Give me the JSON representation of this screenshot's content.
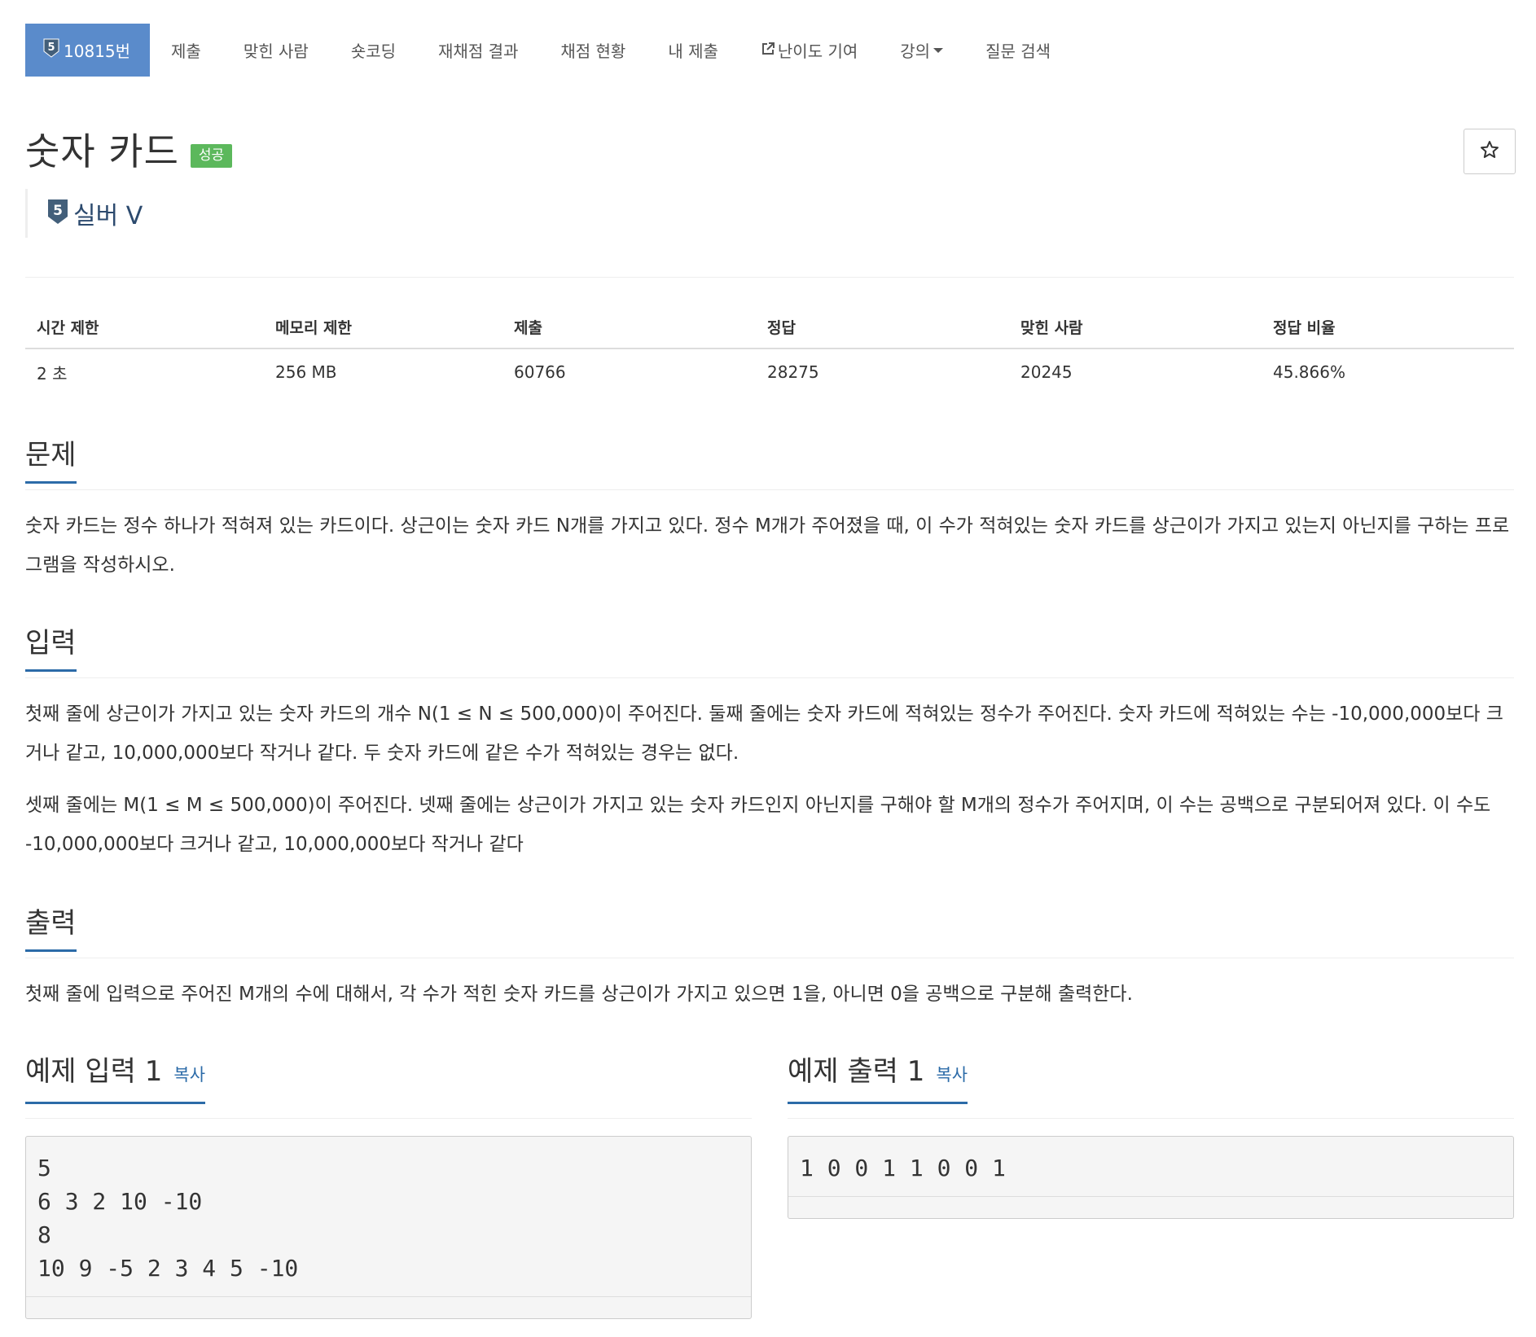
{
  "nav": {
    "problem_id": "10815번",
    "tier_number": "5",
    "items": [
      "제출",
      "맞힌 사람",
      "숏코딩",
      "재채점 결과",
      "채점 현황",
      "내 제출",
      "난이도 기여",
      "강의",
      "질문 검색"
    ]
  },
  "header": {
    "title": "숫자 카드",
    "result_badge": "성공",
    "tier_label": "실버 V",
    "tier_number": "5"
  },
  "info": {
    "headers": [
      "시간 제한",
      "메모리 제한",
      "제출",
      "정답",
      "맞힌 사람",
      "정답 비율"
    ],
    "values": [
      "2 초",
      "256 MB",
      "60766",
      "28275",
      "20245",
      "45.866%"
    ]
  },
  "problem": {
    "title": "문제",
    "paragraphs": [
      "숫자 카드는 정수 하나가 적혀져 있는 카드이다. 상근이는 숫자 카드 N개를 가지고 있다. 정수 M개가 주어졌을 때, 이 수가 적혀있는 숫자 카드를 상근이가 가지고 있는지 아닌지를 구하는 프로그램을 작성하시오."
    ]
  },
  "input": {
    "title": "입력",
    "paragraphs": [
      "첫째 줄에 상근이가 가지고 있는 숫자 카드의 개수 N(1 ≤ N ≤ 500,000)이 주어진다. 둘째 줄에는 숫자 카드에 적혀있는 정수가 주어진다. 숫자 카드에 적혀있는 수는 -10,000,000보다 크거나 같고, 10,000,000보다 작거나 같다. 두 숫자 카드에 같은 수가 적혀있는 경우는 없다.",
      "셋째 줄에는 M(1 ≤ M ≤ 500,000)이 주어진다. 넷째 줄에는 상근이가 가지고 있는 숫자 카드인지 아닌지를 구해야 할 M개의 정수가 주어지며, 이 수는 공백으로 구분되어져 있다. 이 수도 -10,000,000보다 크거나 같고, 10,000,000보다 작거나 같다"
    ]
  },
  "output": {
    "title": "출력",
    "paragraphs": [
      "첫째 줄에 입력으로 주어진 M개의 수에 대해서, 각 수가 적힌 숫자 카드를 상근이가 가지고 있으면 1을, 아니면 0을 공백으로 구분해 출력한다."
    ]
  },
  "samples": {
    "input_title": "예제 입력 1",
    "output_title": "예제 출력 1",
    "copy_label": "복사",
    "input_text": "5\n6 3 2 10 -10\n8\n10 9 -5 2 3 4 5 -10",
    "output_text": "1 0 0 1 1 0 0 1"
  },
  "icons": {
    "tier": "tier-shield-icon",
    "external": "external-link-icon",
    "star": "star-outline-icon",
    "caret": "caret-down-icon"
  },
  "colors": {
    "accent": "#5a8bcb",
    "success": "#5cb85c",
    "link": "#2c6ba8",
    "tier_silver": "#435f7a"
  }
}
